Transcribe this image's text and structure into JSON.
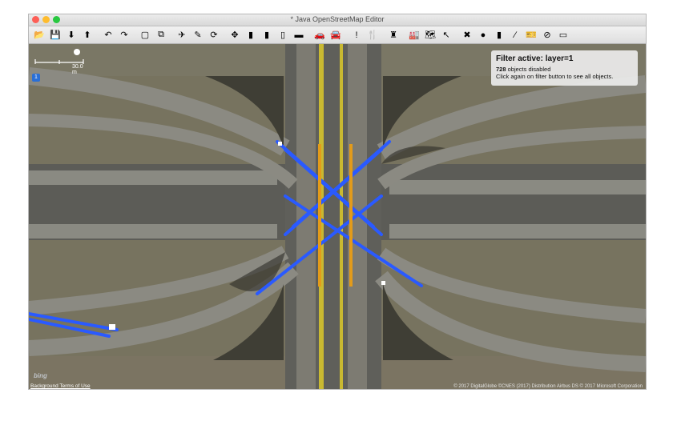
{
  "window": {
    "title": "* Java OpenStreetMap Editor"
  },
  "toolbar": {
    "groups": [
      [
        {
          "name": "open-icon",
          "glyph": "📂"
        },
        {
          "name": "save-icon",
          "glyph": "💾"
        },
        {
          "name": "download-icon",
          "glyph": "⬇"
        },
        {
          "name": "upload-icon",
          "glyph": "⬆"
        }
      ],
      [
        {
          "name": "undo-icon",
          "glyph": "↶"
        },
        {
          "name": "redo-icon",
          "glyph": "↷"
        }
      ],
      [
        {
          "name": "preferences-icon",
          "glyph": "▢"
        },
        {
          "name": "filter-icon",
          "glyph": "⧉"
        }
      ],
      [
        {
          "name": "tool-a-icon",
          "glyph": "✈"
        },
        {
          "name": "tool-b-icon",
          "glyph": "✎"
        },
        {
          "name": "refresh-icon",
          "glyph": "⟳"
        }
      ],
      [
        {
          "name": "move-icon",
          "glyph": "✥"
        },
        {
          "name": "road-icon",
          "glyph": "▮"
        },
        {
          "name": "road2-icon",
          "glyph": "▮"
        },
        {
          "name": "traffic-light-icon",
          "glyph": "▯"
        },
        {
          "name": "building-icon",
          "glyph": "▬"
        }
      ],
      [
        {
          "name": "car-icon",
          "glyph": "🚗"
        },
        {
          "name": "car2-icon",
          "glyph": "🚘"
        }
      ],
      [
        {
          "name": "warning-icon",
          "glyph": "!"
        },
        {
          "name": "restaurant-icon",
          "glyph": "🍴"
        }
      ],
      [
        {
          "name": "castle-icon",
          "glyph": "♜"
        }
      ],
      [
        {
          "name": "factory-icon",
          "glyph": "🏭"
        },
        {
          "name": "map-icon",
          "glyph": "🗺"
        },
        {
          "name": "select-icon",
          "glyph": "↖"
        }
      ],
      [
        {
          "name": "delete-icon",
          "glyph": "✖"
        },
        {
          "name": "stone-icon",
          "glyph": "●"
        },
        {
          "name": "lane-icon",
          "glyph": "▮"
        },
        {
          "name": "tool-c-icon",
          "glyph": "∕"
        },
        {
          "name": "ticket-icon",
          "glyph": "🎫"
        },
        {
          "name": "no-entry-icon",
          "glyph": "⊘"
        },
        {
          "name": "sign-icon",
          "glyph": "▭"
        }
      ]
    ]
  },
  "map": {
    "scale_label": "30.0 m",
    "layer_badge": "1",
    "filter": {
      "title": "Filter active: layer=1",
      "count": "728",
      "line1_suffix": " objects disabled",
      "line2": "Click again on filter button to see all objects."
    },
    "bing": "bing",
    "terms": "Background Terms of Use",
    "attribution": "© 2017 DigitalGlobe ©CNES (2017) Distribution Airbus DS © 2017 Microsoft Corporation"
  }
}
